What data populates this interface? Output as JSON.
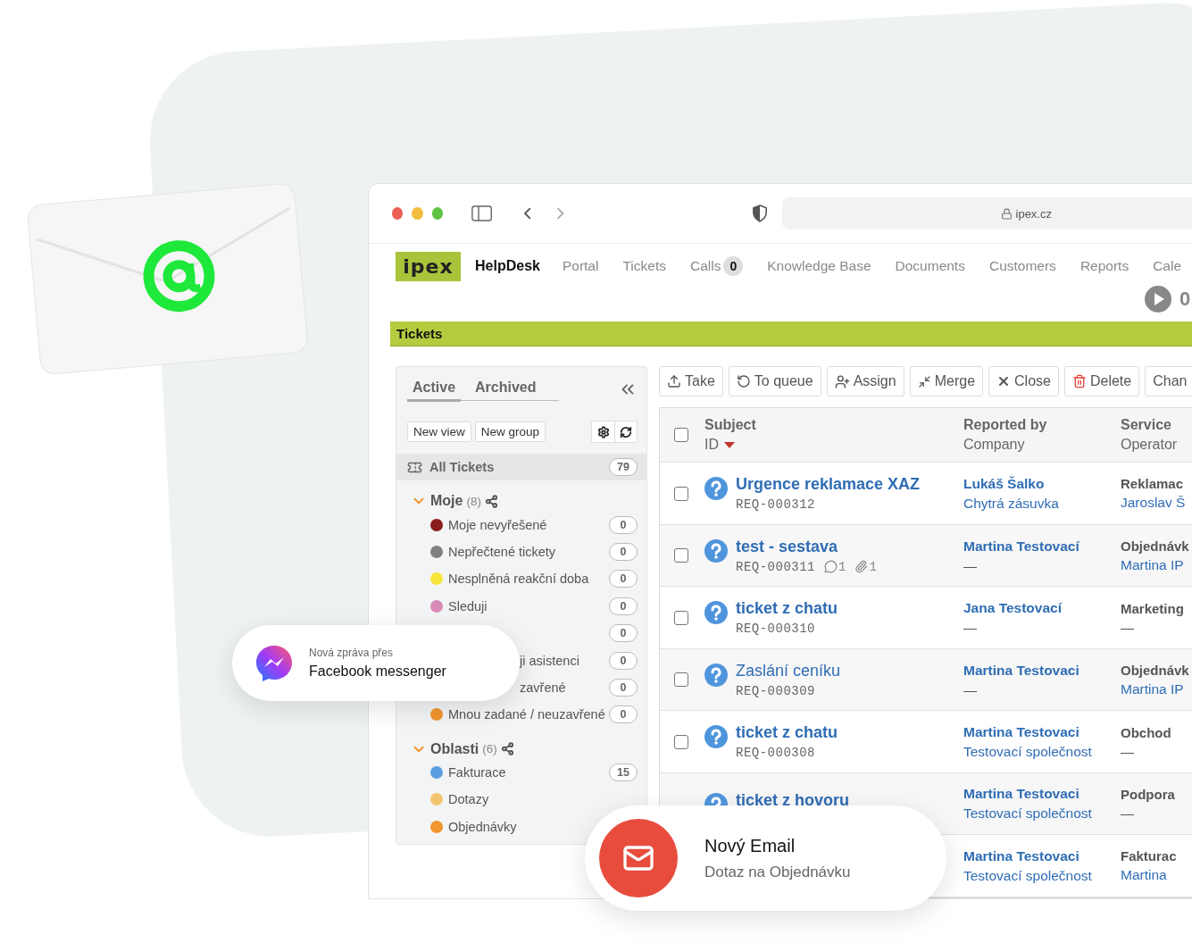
{
  "browser": {
    "url": "ipex.cz"
  },
  "nav": {
    "logo": "ipex",
    "app_name": "HelpDesk",
    "items": [
      {
        "label": "Portal"
      },
      {
        "label": "Tickets"
      },
      {
        "label": "Calls",
        "badge": "0"
      },
      {
        "label": "Knowledge Base"
      },
      {
        "label": "Documents"
      },
      {
        "label": "Customers"
      },
      {
        "label": "Reports"
      },
      {
        "label": "Cale"
      }
    ],
    "player_count": "0"
  },
  "section_title": "Tickets",
  "sidebar": {
    "tabs": [
      {
        "label": "Active",
        "selected": true
      },
      {
        "label": "Archived",
        "selected": false
      }
    ],
    "buttons": [
      "New view",
      "New group"
    ],
    "all_tickets": {
      "label": "All Tickets",
      "count": "79",
      "selected": true
    },
    "groups": [
      {
        "name": "Moje",
        "count": "(8)",
        "expanded": true,
        "items": [
          {
            "kind": "normal",
            "color": "#8b1c1c",
            "label": "Moje nevyřešené",
            "count": "0"
          },
          {
            "kind": "normal",
            "color": "#808080",
            "label": "Nepřečtené tickety",
            "count": "0"
          },
          {
            "kind": "normal",
            "color": "#f7e43a",
            "label": "Nesplněná reakční doba",
            "count": "0"
          },
          {
            "kind": "normal",
            "color": "#d98bb8",
            "label": "Sleduji",
            "count": "0"
          },
          {
            "count": "0"
          },
          {
            "kind": "covered",
            "label": "ji asistenci",
            "count": "0"
          },
          {
            "kind": "covered",
            "label": "zavřené",
            "count": "0"
          },
          {
            "kind": "normal",
            "color": "#f0962e",
            "label": "Mnou zadané / neuzavřené",
            "count": "0"
          }
        ]
      },
      {
        "name": "Oblasti",
        "count": "(6)",
        "expanded": true,
        "items": [
          {
            "kind": "normal",
            "color": "#5aa0e0",
            "label": "Fakturace",
            "count": "15"
          },
          {
            "kind": "normal",
            "color": "#f5c470",
            "label": "Dotazy"
          },
          {
            "kind": "normal",
            "color": "#f0962e",
            "label": "Objednávky"
          }
        ]
      }
    ]
  },
  "toolbar": [
    {
      "kind": "take",
      "label": "Take"
    },
    {
      "kind": "queue",
      "label": "To queue"
    },
    {
      "kind": "assign",
      "label": "Assign"
    },
    {
      "kind": "merge",
      "label": "Merge"
    },
    {
      "kind": "close",
      "label": "Close"
    },
    {
      "kind": "delete",
      "label": "Delete"
    },
    {
      "kind": "plain",
      "label": "Chan"
    }
  ],
  "table": {
    "select_all": {
      "checked": false
    },
    "columns": [
      {
        "title": "Subject",
        "subtitle": "ID",
        "sorted_descending": true
      },
      {
        "title": "Reported by",
        "subtitle": "Company"
      },
      {
        "title": "Service",
        "subtitle": "Operator"
      }
    ],
    "rows": [
      {
        "checked": false,
        "unread": true,
        "subject": "Urgence reklamace XAZ",
        "id": "REQ-000312",
        "reporter": "Lukáš Šalko",
        "company": "Chytrá zásuvka",
        "service": "Reklamac",
        "operator": "Jaroslav Š"
      },
      {
        "checked": false,
        "unread": true,
        "subject": "test - sestava",
        "id": "REQ-000311",
        "comments": "1",
        "attachments": "1",
        "reporter": "Martina Testovací",
        "company": "—",
        "service": "Objednávk",
        "operator": "Martina IP"
      },
      {
        "checked": false,
        "unread": true,
        "subject": "ticket z chatu",
        "id": "REQ-000310",
        "reporter": "Jana Testovací",
        "company": "—",
        "service": "Marketing",
        "operator": "—"
      },
      {
        "checked": false,
        "unread": false,
        "subject": "Zaslání ceníku",
        "id": "REQ-000309",
        "reporter": "Martina Testovaci",
        "company": "—",
        "service": "Objednávk",
        "operator": "Martina IP"
      },
      {
        "checked": false,
        "unread": true,
        "subject": "ticket z chatu",
        "id": "REQ-000308",
        "reporter": "Martina Testovaci",
        "company": "Testovací společnost",
        "service": "Obchod",
        "operator": "—"
      },
      {
        "unread": true,
        "subject": "ticket z hovoru",
        "reporter": "Martina Testovaci",
        "company": "Testovací společnost",
        "service": "Podpora",
        "operator": "—"
      },
      {
        "reporter": "Martina Testovaci",
        "company": "Testovací společnost",
        "service": "Fakturac",
        "operator": "Martina"
      }
    ]
  },
  "messenger_toast": {
    "caption": "Nová zpráva přes",
    "title": "Facebook messenger"
  },
  "email_toast": {
    "title": "Nový Email",
    "subtitle": "Dotaz na Objednávku"
  }
}
